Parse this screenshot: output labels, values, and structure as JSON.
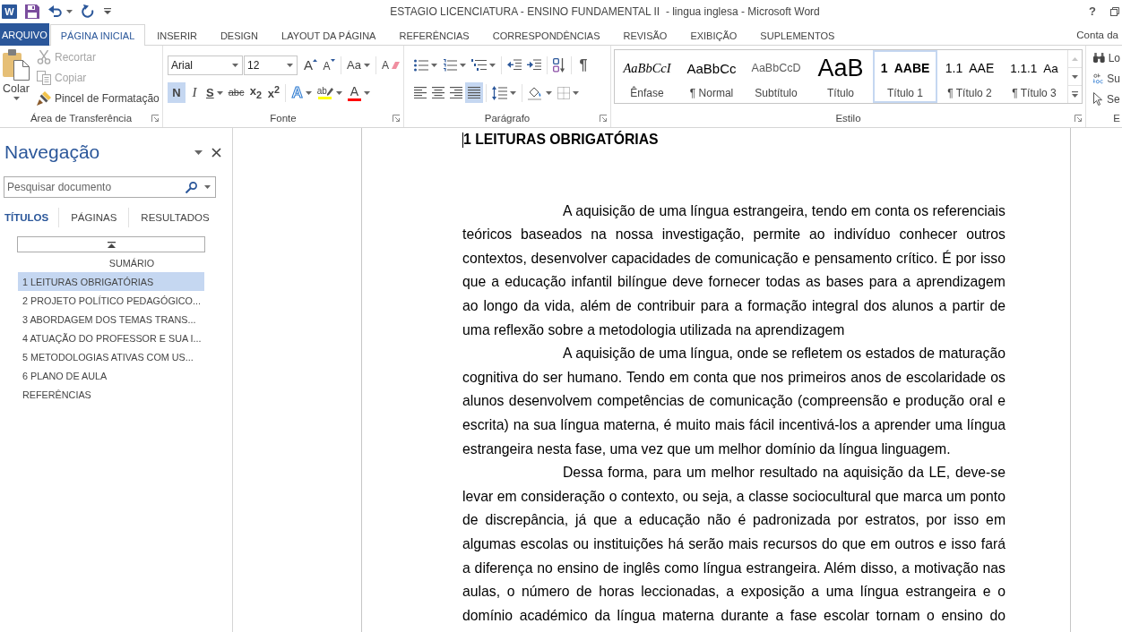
{
  "title_bar": {
    "app_letter": "W",
    "title": "ESTAGIO LICENCIATURA - ENSINO FUNDAMENTAL II  - lingua inglesa - Microsoft Word",
    "help": "?"
  },
  "ribbon_tabs": [
    {
      "label": "ARQUIVO",
      "kind": "file",
      "selected": false
    },
    {
      "label": "PÁGINA INICIAL",
      "kind": "tab",
      "selected": true
    },
    {
      "label": "INSERIR",
      "kind": "tab",
      "selected": false
    },
    {
      "label": "DESIGN",
      "kind": "tab",
      "selected": false
    },
    {
      "label": "LAYOUT DA PÁGINA",
      "kind": "tab",
      "selected": false
    },
    {
      "label": "REFERÊNCIAS",
      "kind": "tab",
      "selected": false
    },
    {
      "label": "CORRESPONDÊNCIAS",
      "kind": "tab",
      "selected": false
    },
    {
      "label": "REVISÃO",
      "kind": "tab",
      "selected": false
    },
    {
      "label": "EXIBIÇÃO",
      "kind": "tab",
      "selected": false
    },
    {
      "label": "SUPLEMENTOS",
      "kind": "tab",
      "selected": false
    }
  ],
  "account": "Conta da",
  "ribbon": {
    "clipboard": {
      "label": "Área de Transferência",
      "paste": "Colar",
      "commands": [
        {
          "kind": "cut",
          "label": "Recortar",
          "disabled": true
        },
        {
          "kind": "copy",
          "label": "Copiar",
          "disabled": true
        },
        {
          "kind": "format_painter",
          "label": "Pincel de Formatação",
          "disabled": false
        }
      ]
    },
    "font": {
      "label": "Fonte",
      "font_name": "Arial",
      "font_size": "12",
      "tools": [
        {
          "kind": "grow",
          "label": "A"
        },
        {
          "kind": "shrink",
          "label": "A"
        },
        {
          "kind": "case",
          "label": "Aa"
        },
        {
          "kind": "clear",
          "label": "A"
        }
      ],
      "buttons": [
        {
          "kind": "bold",
          "label": "N",
          "selected": true
        },
        {
          "kind": "italic",
          "label": "I",
          "selected": false
        },
        {
          "kind": "underline",
          "label": "S",
          "selected": false
        },
        {
          "kind": "strike",
          "label": "abc",
          "selected": false
        },
        {
          "kind": "subscript",
          "label": "x$_{2}$",
          "selected": false
        },
        {
          "kind": "superscript",
          "label": "x$^{2}$",
          "selected": false
        }
      ],
      "color_tools": [
        {
          "kind": "effects",
          "label": "A"
        },
        {
          "kind": "highlight",
          "label": "ab",
          "color": "#ffff00"
        },
        {
          "kind": "font_color",
          "label": "A",
          "color": "#ff0000"
        }
      ]
    },
    "paragraph": {
      "label": "Parágrafo",
      "show_marks": "¶",
      "alignments": [
        {
          "kind": "left",
          "selected": false
        },
        {
          "kind": "center",
          "selected": false
        },
        {
          "kind": "right",
          "selected": false
        },
        {
          "kind": "justify",
          "selected": true
        }
      ]
    },
    "styles": {
      "label": "Estilo",
      "items": [
        {
          "kind": "emphasis",
          "preview": "AaBbCcI",
          "name": "Ênfase",
          "selected": false
        },
        {
          "kind": "normal",
          "preview": "AaBbCc",
          "name": "¶ Normal",
          "selected": false
        },
        {
          "kind": "subtitle",
          "preview": "AaBbCcD",
          "name": "Subtítulo",
          "selected": false
        },
        {
          "kind": "title",
          "preview": "AaB",
          "name": "Título",
          "selected": false
        },
        {
          "kind": "heading1",
          "preview": "1  AABE",
          "name": "Título 1",
          "selected": true
        },
        {
          "kind": "heading2",
          "preview": "1.1  AAE",
          "name": "¶ Título 2",
          "selected": false
        },
        {
          "kind": "heading3",
          "preview": "1.1.1  Aa",
          "name": "¶ Título 3",
          "selected": false
        }
      ]
    },
    "editing": {
      "label": "E",
      "commands": [
        {
          "kind": "find",
          "label": "Lo"
        },
        {
          "kind": "replace",
          "label": "Su"
        },
        {
          "kind": "select",
          "label": "Se"
        }
      ]
    }
  },
  "navigation": {
    "title": "Navegação",
    "search": {
      "placeholder": "Pesquisar documento"
    },
    "tabs": [
      {
        "label": "TÍTULOS",
        "selected": true
      },
      {
        "label": "PÁGINAS",
        "selected": false
      },
      {
        "label": "RESULTADOS",
        "selected": false
      }
    ],
    "headings": [
      {
        "label": "SUMÁRIO",
        "kind": "centered",
        "selected": false
      },
      {
        "label": "1 LEITURAS OBRIGATÓRIAS",
        "kind": "heading",
        "selected": true
      },
      {
        "label": "2 PROJETO POLÍTICO PEDAGÓGICO...",
        "kind": "heading",
        "selected": false
      },
      {
        "label": "3 ABORDAGEM DOS TEMAS TRANS...",
        "kind": "heading",
        "selected": false
      },
      {
        "label": "4 ATUAÇÃO DO PROFESSOR E SUA I...",
        "kind": "heading",
        "selected": false
      },
      {
        "label": "5 METODOLOGIAS ATIVAS COM US...",
        "kind": "heading",
        "selected": false
      },
      {
        "label": "6 PLANO DE AULA",
        "kind": "heading",
        "selected": false
      },
      {
        "label": "REFERÊNCIAS",
        "kind": "heading",
        "selected": false
      }
    ]
  },
  "document": {
    "heading": "1 LEITURAS OBRIGATÓRIAS",
    "paragraphs": [
      "A aquisição de uma língua estrangeira, tendo em conta os referenciais teóricos baseados na nossa investigação, permite ao indivíduo conhecer outros contextos, desenvolver capacidades de comunicação e pensamento crítico. É por isso que a educação infantil bilíngue deve fornecer todas as bases para a aprendizagem ao longo da vida, além de contribuir para a formação integral dos alunos a partir de uma reflexão sobre a metodologia utilizada na aprendizagem",
      "A aquisição de uma língua, onde se refletem os estados de maturação cognitiva do ser humano. Tendo em conta que nos primeiros anos de escolaridade os alunos desenvolvem competências de comunicação (compreensão e produção oral e escrita) na sua língua materna, é muito mais fácil incentivá-los a aprender uma língua estrangeira nesta fase, uma vez que um melhor domínio da língua linguagem.",
      "Dessa forma, para um melhor resultado na aquisição da LE, deve-se levar em consideração o contexto, ou seja, a classe sociocultural que marca um ponto de discrepância, já que a educação não é padronizada por estratos, por isso em algumas escolas ou instituições há serão mais recursos do que em outros e isso fará a diferença no ensino de inglês como língua estrangeira. Além disso, a motivação nas aulas, o número de horas leccionadas, a exposição a uma língua estrangeira e o domínio académico da língua materna durante a fase escolar tornam o ensino do"
    ]
  }
}
